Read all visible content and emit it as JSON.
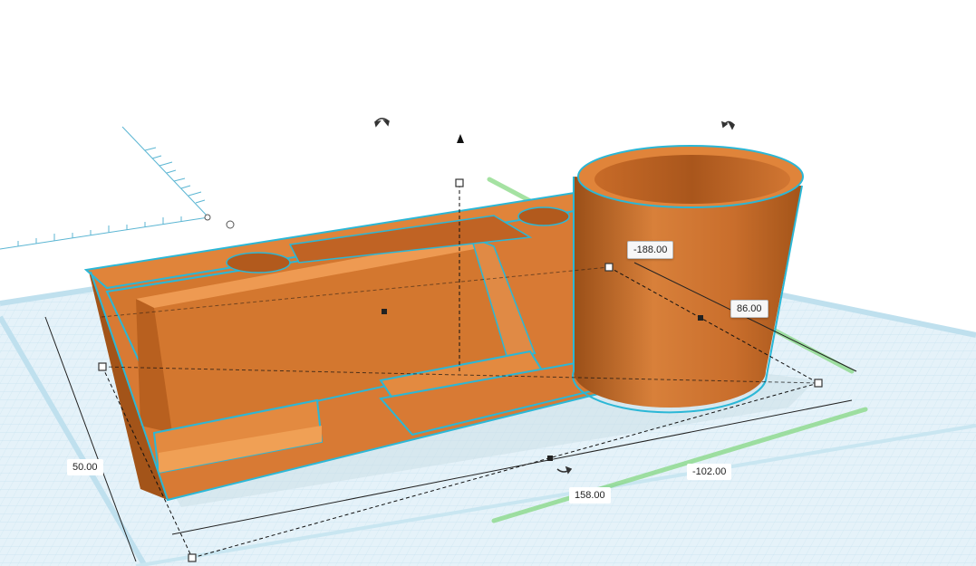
{
  "colors": {
    "shape_fill": "#e0843a",
    "shape_dark": "#b85f20",
    "shape_shadow": "#9c4e17",
    "selection_outline": "#2bb7d6",
    "grid_fill": "#e3f1f8",
    "grid_line": "#c3e0ee",
    "grid_major": "#9fcde2",
    "grid_border": "#bfe0ee",
    "axis_green": "#6fd06a",
    "ruler_blue": "#5cb6d3"
  },
  "icons": {
    "move_up": "triangle-up-arrow-icon",
    "rotate": "rotate-arrow-icon",
    "handle": "square-handle-icon"
  },
  "dimensions": {
    "height": "50.00",
    "length": "158.00",
    "width": "-102.00",
    "offset_x": "-188.00",
    "offset_y": "86.00"
  }
}
